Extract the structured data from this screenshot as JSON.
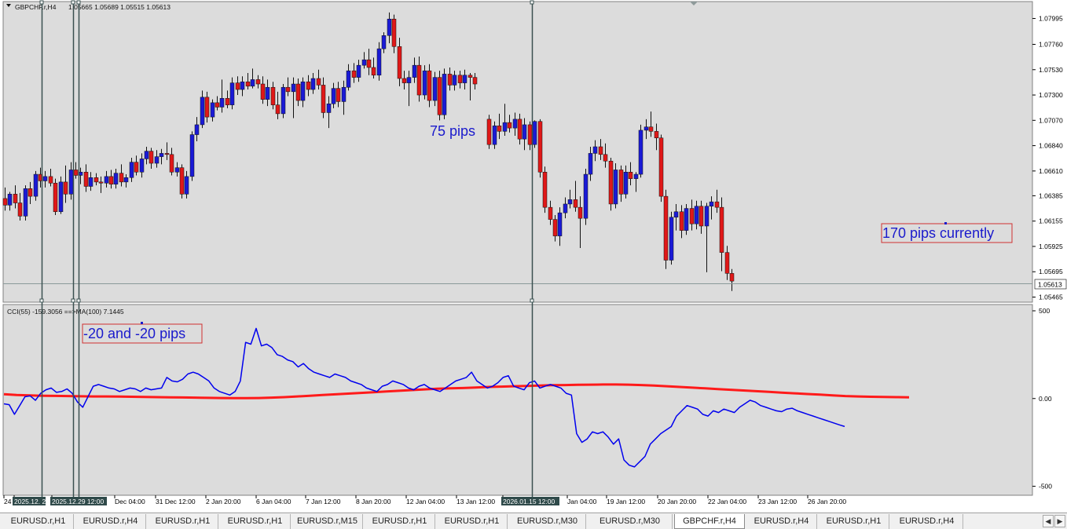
{
  "window": {
    "symbol_info": "GBPCHF.r,H4",
    "ohlc": "1.05665 1.05689 1.05515 1.05613",
    "current_price": "1.05613"
  },
  "colors": {
    "chart_bg": "#dcdcdc",
    "bull_candle": "#1a1ad6",
    "bear_candle": "#e01818",
    "doji": "#00c800",
    "cci_line": "#0000ee",
    "ma_line": "#ff1a1a",
    "vline": "#3a5050",
    "annotation_text": "#1a1acc",
    "annotation_border": "#d03030"
  },
  "annotations": {
    "pips_75": "75 pips",
    "pips_170": "170 pips currently",
    "pips_20": "-20 and -20 pips"
  },
  "indicator": {
    "label": "CCI(55) -159.3056  ==>MA(100) 7.1445"
  },
  "chart_data": [
    {
      "type": "candlestick",
      "symbol": "GBPCHF.r",
      "timeframe": "H4",
      "y_ticks": [
        "1.07995",
        "1.07760",
        "1.07530",
        "1.07300",
        "1.07070",
        "1.06840",
        "1.06610",
        "1.06385",
        "1.06155",
        "1.05925",
        "1.05695",
        "1.05465"
      ],
      "ylim": [
        1.0544,
        1.0812
      ],
      "bars": [
        [
          1.0636,
          1.0646,
          1.0625,
          1.063
        ],
        [
          1.063,
          1.0642,
          1.0625,
          1.064
        ],
        [
          1.064,
          1.0648,
          1.0627,
          1.0632
        ],
        [
          1.0632,
          1.0641,
          1.0616,
          1.062
        ],
        [
          1.062,
          1.0648,
          1.0616,
          1.0645
        ],
        [
          1.0645,
          1.0651,
          1.0631,
          1.0638
        ],
        [
          1.0638,
          1.0661,
          1.0634,
          1.0658
        ],
        [
          1.0658,
          1.0664,
          1.0646,
          1.0652
        ],
        [
          1.0652,
          1.0661,
          1.0646,
          1.0656
        ],
        [
          1.0656,
          1.0663,
          1.0647,
          1.065
        ],
        [
          1.065,
          1.0654,
          1.0621,
          1.0624
        ],
        [
          1.0624,
          1.0656,
          1.0622,
          1.0651
        ],
        [
          1.0651,
          1.0666,
          1.0632,
          1.064
        ],
        [
          1.064,
          1.0669,
          1.0635,
          1.0662
        ],
        [
          1.0662,
          1.0669,
          1.0654,
          1.0657
        ],
        [
          1.0657,
          1.0664,
          1.0649,
          1.066
        ],
        [
          1.066,
          1.0667,
          1.0642,
          1.0647
        ],
        [
          1.0647,
          1.066,
          1.0643,
          1.0655
        ],
        [
          1.0655,
          1.0659,
          1.0648,
          1.0651
        ],
        [
          1.0651,
          1.0656,
          1.0641,
          1.065
        ],
        [
          1.065,
          1.0661,
          1.0646,
          1.0656
        ],
        [
          1.0656,
          1.0662,
          1.0645,
          1.0649
        ],
        [
          1.0649,
          1.0663,
          1.0645,
          1.0659
        ],
        [
          1.0659,
          1.0667,
          1.0647,
          1.0651
        ],
        [
          1.0651,
          1.0658,
          1.0646,
          1.0655
        ],
        [
          1.0655,
          1.0673,
          1.0651,
          1.0669
        ],
        [
          1.0669,
          1.0675,
          1.0657,
          1.066
        ],
        [
          1.066,
          1.0677,
          1.0655,
          1.0672
        ],
        [
          1.0672,
          1.0683,
          1.0667,
          1.0679
        ],
        [
          1.0679,
          1.0682,
          1.0663,
          1.0668
        ],
        [
          1.0668,
          1.068,
          1.0664,
          1.0674
        ],
        [
          1.0674,
          1.0681,
          1.0667,
          1.0677
        ],
        [
          1.0677,
          1.0687,
          1.0671,
          1.0676
        ],
        [
          1.0676,
          1.0682,
          1.0657,
          1.066
        ],
        [
          1.066,
          1.0669,
          1.0656,
          1.0664
        ],
        [
          1.0664,
          1.0667,
          1.0636,
          1.064
        ],
        [
          1.064,
          1.0661,
          1.0636,
          1.0656
        ],
        [
          1.0656,
          1.0697,
          1.0652,
          1.0694
        ],
        [
          1.0694,
          1.071,
          1.0688,
          1.0703
        ],
        [
          1.0703,
          1.0734,
          1.07,
          1.0728
        ],
        [
          1.0728,
          1.0733,
          1.0705,
          1.071
        ],
        [
          1.071,
          1.0726,
          1.0706,
          1.0723
        ],
        [
          1.0723,
          1.0729,
          1.0716,
          1.0719
        ],
        [
          1.0719,
          1.0744,
          1.0714,
          1.0727
        ],
        [
          1.0727,
          1.0734,
          1.0718,
          1.0721
        ],
        [
          1.0721,
          1.0746,
          1.0717,
          1.0741
        ],
        [
          1.0741,
          1.0747,
          1.073,
          1.0735
        ],
        [
          1.0735,
          1.0747,
          1.0729,
          1.0742
        ],
        [
          1.0742,
          1.075,
          1.0735,
          1.0738
        ],
        [
          1.0738,
          1.0754,
          1.0736,
          1.0744
        ],
        [
          1.0744,
          1.0748,
          1.0736,
          1.074
        ],
        [
          1.074,
          1.0747,
          1.0722,
          1.0726
        ],
        [
          1.0726,
          1.0744,
          1.072,
          1.0737
        ],
        [
          1.0737,
          1.0742,
          1.0717,
          1.0721
        ],
        [
          1.0721,
          1.0733,
          1.0708,
          1.0713
        ],
        [
          1.0713,
          1.074,
          1.0709,
          1.0737
        ],
        [
          1.0737,
          1.0746,
          1.0729,
          1.0733
        ],
        [
          1.0733,
          1.0746,
          1.0709,
          1.074
        ],
        [
          1.074,
          1.0745,
          1.072,
          1.0725
        ],
        [
          1.0725,
          1.0746,
          1.0719,
          1.0742
        ],
        [
          1.0742,
          1.0748,
          1.0729,
          1.0735
        ],
        [
          1.0735,
          1.075,
          1.0731,
          1.0745
        ],
        [
          1.0745,
          1.0753,
          1.0735,
          1.0739
        ],
        [
          1.0739,
          1.0746,
          1.0709,
          1.0714
        ],
        [
          1.0714,
          1.0729,
          1.07,
          1.0722
        ],
        [
          1.0722,
          1.0741,
          1.0718,
          1.0736
        ],
        [
          1.0736,
          1.0742,
          1.0719,
          1.0724
        ],
        [
          1.0724,
          1.0743,
          1.0712,
          1.0737
        ],
        [
          1.0737,
          1.0758,
          1.0734,
          1.0752
        ],
        [
          1.0752,
          1.0759,
          1.0741,
          1.0746
        ],
        [
          1.0746,
          1.0762,
          1.0742,
          1.0757
        ],
        [
          1.0757,
          1.0769,
          1.0754,
          1.0762
        ],
        [
          1.0762,
          1.0772,
          1.0748,
          1.0755
        ],
        [
          1.0755,
          1.0764,
          1.0745,
          1.0748
        ],
        [
          1.0748,
          1.0778,
          1.0743,
          1.0772
        ],
        [
          1.0772,
          1.0787,
          1.0768,
          1.0784
        ],
        [
          1.0784,
          1.0805,
          1.0777,
          1.0799
        ],
        [
          1.0799,
          1.0803,
          1.0768,
          1.0774
        ],
        [
          1.0774,
          1.0782,
          1.0738,
          1.0745
        ],
        [
          1.0745,
          1.0752,
          1.0735,
          1.0741
        ],
        [
          1.0741,
          1.0752,
          1.072,
          1.0746
        ],
        [
          1.0746,
          1.0764,
          1.0741,
          1.0757
        ],
        [
          1.0757,
          1.0765,
          1.0724,
          1.073
        ],
        [
          1.073,
          1.0757,
          1.0726,
          1.0752
        ],
        [
          1.0752,
          1.0758,
          1.0719,
          1.0725
        ],
        [
          1.0725,
          1.0751,
          1.072,
          1.0746
        ],
        [
          1.0746,
          1.0752,
          1.0707,
          1.0712
        ],
        [
          1.0712,
          1.0754,
          1.0708,
          1.0749
        ],
        [
          1.0749,
          1.0755,
          1.0734,
          1.0739
        ],
        [
          1.0739,
          1.0752,
          1.0734,
          1.0748
        ],
        [
          1.0748,
          1.0752,
          1.0736,
          1.0741
        ],
        [
          1.0741,
          1.0753,
          1.0735,
          1.0748
        ],
        [
          1.0748,
          1.075,
          1.0725,
          1.0746
        ],
        [
          1.0746,
          1.075,
          1.0735,
          1.074
        ],
        [
          1.0708,
          1.0712,
          1.0681,
          1.0685
        ],
        [
          1.0685,
          1.0706,
          1.0681,
          1.0702
        ],
        [
          1.0702,
          1.0713,
          1.069,
          1.0697
        ],
        [
          1.0697,
          1.0722,
          1.0693,
          1.0705
        ],
        [
          1.0705,
          1.0712,
          1.0696,
          1.07
        ],
        [
          1.07,
          1.0714,
          1.0693,
          1.0708
        ],
        [
          1.0708,
          1.0713,
          1.0685,
          1.069
        ],
        [
          1.069,
          1.0709,
          1.068,
          1.0703
        ],
        [
          1.0703,
          1.0706,
          1.068,
          1.0685
        ],
        [
          1.0685,
          1.0707,
          1.0682,
          1.0706
        ],
        [
          1.0706,
          1.0708,
          1.0655,
          1.066
        ],
        [
          1.066,
          1.0665,
          1.0623,
          1.0628
        ],
        [
          1.0628,
          1.0634,
          1.0612,
          1.0617
        ],
        [
          1.0617,
          1.0621,
          1.0597,
          1.0602
        ],
        [
          1.0602,
          1.0628,
          1.0593,
          1.0623
        ],
        [
          1.0623,
          1.0637,
          1.0618,
          1.0631
        ],
        [
          1.0631,
          1.0644,
          1.0627,
          1.0635
        ],
        [
          1.0635,
          1.0652,
          1.0624,
          1.0628
        ],
        [
          1.0628,
          1.0638,
          1.0591,
          1.0618
        ],
        [
          1.0618,
          1.0663,
          1.0612,
          1.0658
        ],
        [
          1.0658,
          1.0683,
          1.0652,
          1.0677
        ],
        [
          1.0677,
          1.0689,
          1.067,
          1.0683
        ],
        [
          1.0683,
          1.069,
          1.0671,
          1.0676
        ],
        [
          1.0676,
          1.0686,
          1.0664,
          1.067
        ],
        [
          1.067,
          1.0673,
          1.0625,
          1.0631
        ],
        [
          1.0631,
          1.0668,
          1.0627,
          1.0662
        ],
        [
          1.0662,
          1.0666,
          1.0633,
          1.064
        ],
        [
          1.064,
          1.0666,
          1.0636,
          1.066
        ],
        [
          1.066,
          1.0669,
          1.0648,
          1.0654
        ],
        [
          1.0654,
          1.066,
          1.0642,
          1.0658
        ],
        [
          1.0658,
          1.0703,
          1.0655,
          1.0698
        ],
        [
          1.0698,
          1.0708,
          1.069,
          1.0701
        ],
        [
          1.0701,
          1.0715,
          1.0692,
          1.0697
        ],
        [
          1.0697,
          1.0704,
          1.068,
          1.0691
        ],
        [
          1.0691,
          1.0694,
          1.0633,
          1.0638
        ],
        [
          1.0638,
          1.0644,
          1.0572,
          1.058
        ],
        [
          1.058,
          1.0624,
          1.0576,
          1.0619
        ],
        [
          1.0619,
          1.0631,
          1.0607,
          1.0624
        ],
        [
          1.0624,
          1.063,
          1.06,
          1.0607
        ],
        [
          1.0607,
          1.0631,
          1.0603,
          1.0627
        ],
        [
          1.0627,
          1.0635,
          1.0607,
          1.0613
        ],
        [
          1.0613,
          1.0634,
          1.0608,
          1.0629
        ],
        [
          1.0629,
          1.0634,
          1.0604,
          1.0611
        ],
        [
          1.0611,
          1.0632,
          1.0569,
          1.0629
        ],
        [
          1.0629,
          1.0638,
          1.0617,
          1.0633
        ],
        [
          1.0633,
          1.0644,
          1.0623,
          1.0628
        ],
        [
          1.0628,
          1.0637,
          1.057,
          1.0587
        ],
        [
          1.0587,
          1.0593,
          1.0562,
          1.0568
        ],
        [
          1.0568,
          1.0572,
          1.0552,
          1.0561
        ]
      ]
    },
    {
      "type": "line",
      "indicator": "CCI(55) with MA(100)",
      "y_ticks": [
        "500",
        "0.00",
        "-500"
      ],
      "ylim": [
        -520,
        500
      ],
      "series": [
        {
          "values": [
            -30,
            -35,
            -90,
            -40,
            10,
            15,
            -10,
            30,
            50,
            60,
            35,
            40,
            55,
            30,
            -20,
            -50,
            10,
            70,
            80,
            70,
            60,
            55,
            40,
            50,
            60,
            55,
            40,
            60,
            50,
            55,
            60,
            120,
            100,
            95,
            110,
            140,
            150,
            140,
            120,
            100,
            60,
            40,
            30,
            20,
            40,
            100,
            320,
            310,
            400,
            300,
            310,
            290,
            250,
            240,
            220,
            210,
            180,
            200,
            170,
            150,
            140,
            130,
            120,
            140,
            130,
            120,
            100,
            90,
            80,
            60,
            50,
            40,
            70,
            80,
            100,
            90,
            80,
            60,
            50,
            70,
            80,
            60,
            50,
            40,
            60,
            80,
            100,
            110,
            120,
            150,
            100,
            80,
            60,
            70,
            90,
            120,
            130,
            70,
            60,
            50,
            90,
            100,
            60,
            70,
            80,
            70,
            60,
            30,
            20,
            -200,
            -250,
            -230,
            -190,
            -200,
            -190,
            -220,
            -260,
            -230,
            -350,
            -380,
            -390,
            -360,
            -330,
            -260,
            -230,
            -200,
            -180,
            -160,
            -100,
            -70,
            -40,
            -50,
            -60,
            -90,
            -100,
            -70,
            -80,
            -60,
            -70,
            -80,
            -50,
            -30,
            -10,
            -20,
            -40,
            -50,
            -60,
            -70,
            -75,
            -60,
            -55,
            -70,
            -80,
            -90,
            -100,
            -110,
            -120,
            -130,
            -140,
            -150,
            -159.3056
          ]
        },
        {
          "values": [
            25,
            20,
            18,
            16,
            15,
            14,
            13,
            12,
            12,
            11,
            10,
            9,
            8,
            7,
            6,
            5,
            4,
            3,
            2,
            2,
            3,
            5,
            8,
            12,
            16,
            20,
            24,
            28,
            32,
            36,
            40,
            44,
            48,
            52,
            56,
            58,
            60,
            63,
            66,
            68,
            70,
            72,
            74,
            76,
            77,
            78,
            79,
            80,
            80,
            79,
            77,
            74,
            70,
            66,
            62,
            58,
            54,
            50,
            46,
            42,
            38,
            34,
            30,
            26,
            22,
            18,
            14,
            12,
            10,
            9,
            8,
            7.1445
          ]
        }
      ]
    }
  ],
  "x_labels": [
    "24",
    "2025.12. 2",
    "2025.12.29 12:00",
    "Dec 04:00",
    "31 Dec 12:00",
    "2 Jan 20:00",
    "6 Jan 04:00",
    "7 Jan 12:00",
    "8 Jan 20:00",
    "12 Jan 04:00",
    "13 Jan 12:00",
    "2026.01.15 12:00",
    "Jan 04:00",
    "19 Jan 12:00",
    "20 Jan 20:00",
    "22 Jan 04:00",
    "23 Jan 12:00",
    "26 Jan 20:00"
  ],
  "tabs": [
    "EURUSD.r,H1",
    "EURUSD.r,H4",
    "EURUSD.r,H1",
    "EURUSD.r,H1",
    "EURUSD.r,M15",
    "EURUSD.r,H1",
    "EURUSD.r,H1",
    "EURUSD.r,M30",
    "EURUSD.r,M30",
    "GBPCHF.r,H4",
    "EURUSD.r,H4",
    "EURUSD.r,H1",
    "EURUSD.r,H4"
  ],
  "active_tab_index": 9
}
